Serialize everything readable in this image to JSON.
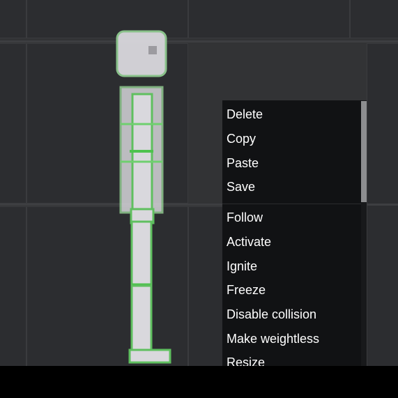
{
  "context_menu": {
    "items": [
      {
        "label": "Delete"
      },
      {
        "label": "Copy"
      },
      {
        "label": "Paste"
      },
      {
        "label": "Save"
      },
      {
        "label": "Follow"
      },
      {
        "label": "Activate"
      },
      {
        "label": "Ignite"
      },
      {
        "label": "Freeze"
      },
      {
        "label": "Disable collision"
      },
      {
        "label": "Make weightless"
      },
      {
        "label": "Resize"
      }
    ]
  },
  "colors": {
    "background": "#323335",
    "menu_background": "#111214",
    "menu_text": "#ffffff",
    "selection_outline": "#5fbf5f",
    "ragdoll_fill": "#d9d8dd"
  },
  "icons": [
    "ragdoll-human"
  ]
}
